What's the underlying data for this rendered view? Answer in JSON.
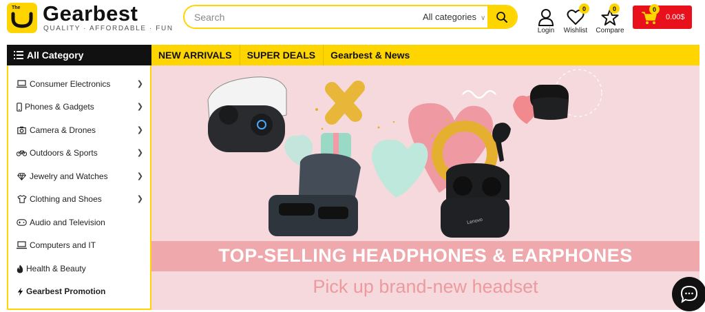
{
  "logo": {
    "badge_text": "The",
    "name": "Gearbest",
    "tagline": "QUALITY · AFFORDABLE · FUN"
  },
  "search": {
    "placeholder": "Search",
    "category": "All categories",
    "icon": "search-icon"
  },
  "header_actions": [
    {
      "label": "Login",
      "icon": "user-icon"
    },
    {
      "label": "Wishlist",
      "icon": "heart-icon",
      "count": "0"
    },
    {
      "label": "Compare",
      "icon": "star-icon",
      "count": "0"
    }
  ],
  "cart": {
    "count": "0",
    "total": "0.00$",
    "icon": "cart-icon"
  },
  "nav": {
    "all_category": "All Category",
    "links": [
      "NEW ARRIVALS",
      "SUPER DEALS",
      "Gearbest & News"
    ]
  },
  "sidebar": {
    "items": [
      {
        "label": "Consumer Electronics",
        "icon": "laptop-icon",
        "has_submenu": true
      },
      {
        "label": "Phones & Gadgets",
        "icon": "phone-icon",
        "has_submenu": true
      },
      {
        "label": "Camera & Drones",
        "icon": "camera-icon",
        "has_submenu": true
      },
      {
        "label": "Outdoors & Sports",
        "icon": "bicycle-icon",
        "has_submenu": true
      },
      {
        "label": "Jewelry and Watches",
        "icon": "diamond-icon",
        "has_submenu": true
      },
      {
        "label": "Clothing and Shoes",
        "icon": "shirt-icon",
        "has_submenu": true
      },
      {
        "label": "Audio and Television",
        "icon": "gamepad-icon",
        "has_submenu": false
      },
      {
        "label": "Computers and IT",
        "icon": "laptop-icon",
        "has_submenu": false
      },
      {
        "label": "Health & Beauty",
        "icon": "flame-icon",
        "has_submenu": false
      },
      {
        "label": "Gearbest Promotion",
        "icon": "bolt-icon",
        "has_submenu": false
      }
    ]
  },
  "banner": {
    "headline": "TOP-SELLING HEADPHONES & EARPHONES",
    "subline": "Pick up brand-new headset",
    "earbud_case_brand": "Lenovo"
  },
  "colors": {
    "brand_yellow": "#ffd500",
    "cart_red": "#e8101b",
    "banner_pink": "#f6d9dc"
  }
}
